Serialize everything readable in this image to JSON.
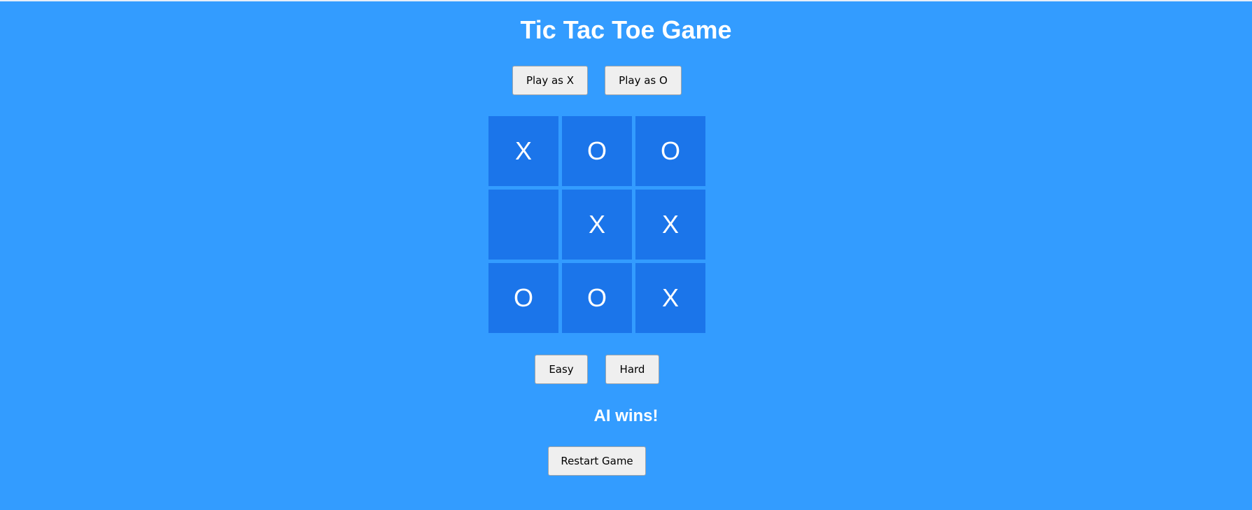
{
  "game": {
    "title": "Tic Tac Toe Game",
    "choose_side": {
      "play_x_label": "Play as X",
      "play_o_label": "Play as O"
    },
    "board": {
      "cells": [
        "X",
        "O",
        "O",
        "",
        "X",
        "X",
        "O",
        "O",
        "X"
      ]
    },
    "difficulty": {
      "easy_label": "Easy",
      "hard_label": "Hard"
    },
    "status": "AI wins!",
    "restart_label": "Restart Game"
  },
  "colors": {
    "background": "#339cff",
    "cell": "#1b75ea",
    "text": "#ffffff",
    "button": "#efefef"
  }
}
